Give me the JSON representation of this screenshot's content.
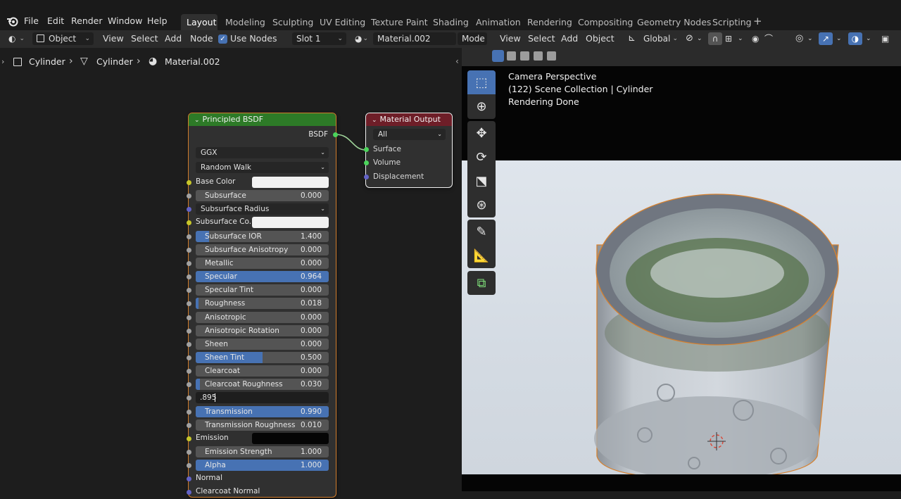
{
  "topbar": {
    "menus": [
      "File",
      "Edit",
      "Render",
      "Window",
      "Help"
    ],
    "workspaces": [
      "Layout",
      "Modeling",
      "Sculpting",
      "UV Editing",
      "Texture Paint",
      "Shading",
      "Animation",
      "Rendering",
      "Compositing",
      "Geometry Nodes",
      "Scripting"
    ],
    "active_workspace": "Layout"
  },
  "node_editor": {
    "header": {
      "mode": "Object",
      "menus": [
        "View",
        "Select",
        "Add",
        "Node"
      ],
      "use_nodes_label": "Use Nodes",
      "slot": "Slot 1",
      "material": "Material.002"
    },
    "breadcrumb": [
      "Cylinder",
      "Cylinder",
      "Material.002"
    ],
    "principled": {
      "title": "Principled BSDF",
      "output": "BSDF",
      "distribution": "GGX",
      "subsurface_method": "Random Walk",
      "inputs": [
        {
          "label": "Base Color",
          "type": "color",
          "color": "#f2f2f2"
        },
        {
          "label": "Subsurface",
          "value": "0.000",
          "fill": 0
        },
        {
          "label": "Subsurface Radius",
          "type": "select"
        },
        {
          "label": "Subsurface Co...",
          "type": "color",
          "color": "#f2f2f2"
        },
        {
          "label": "Subsurface IOR",
          "value": "1.400",
          "fill": 0.1
        },
        {
          "label": "Subsurface Anisotropy",
          "value": "0.000",
          "fill": 0
        },
        {
          "label": "Metallic",
          "value": "0.000",
          "fill": 0
        },
        {
          "label": "Specular",
          "value": "0.964",
          "fill": 1
        },
        {
          "label": "Specular Tint",
          "value": "0.000",
          "fill": 0
        },
        {
          "label": "Roughness",
          "value": "0.018",
          "fill": 0.02
        },
        {
          "label": "Anisotropic",
          "value": "0.000",
          "fill": 0
        },
        {
          "label": "Anisotropic Rotation",
          "value": "0.000",
          "fill": 0
        },
        {
          "label": "Sheen",
          "value": "0.000",
          "fill": 0
        },
        {
          "label": "Sheen Tint",
          "value": "0.500",
          "fill": 0.5
        },
        {
          "label": "Clearcoat",
          "value": "0.000",
          "fill": 0
        },
        {
          "label": "Clearcoat Roughness",
          "value": "0.030",
          "fill": 0.03
        },
        {
          "label": ".895",
          "type": "editing"
        },
        {
          "label": "Transmission",
          "value": "0.990",
          "fill": 1
        },
        {
          "label": "Transmission Roughness",
          "value": "0.010",
          "fill": 0
        },
        {
          "label": "Emission",
          "type": "color",
          "color": "#050505"
        },
        {
          "label": "Emission Strength",
          "value": "1.000",
          "fill": 0
        },
        {
          "label": "Alpha",
          "value": "1.000",
          "fill": 1
        },
        {
          "label": "Normal",
          "type": "plain"
        },
        {
          "label": "Clearcoat Normal",
          "type": "plain"
        }
      ]
    },
    "output_node": {
      "title": "Material Output",
      "target": "All",
      "inputs": [
        "Surface",
        "Volume",
        "Displacement"
      ]
    }
  },
  "viewport": {
    "header": {
      "mode": "Mode",
      "menus": [
        "View",
        "Select",
        "Add",
        "Object"
      ],
      "orientation": "Global"
    },
    "info": [
      "Camera Perspective",
      "(122) Scene Collection | Cylinder",
      "Rendering Done"
    ]
  },
  "colors": {
    "accent": "#4772b3",
    "principled_header": "#2d7a27",
    "output_header": "#6e1e28"
  }
}
